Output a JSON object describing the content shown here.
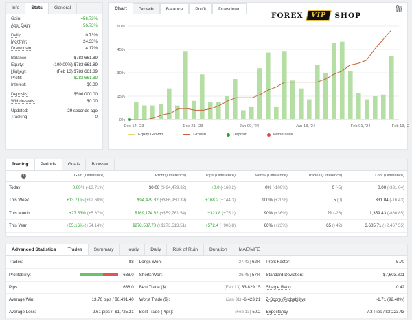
{
  "info_panel": {
    "tabs": [
      "Info",
      "Stats",
      "General"
    ],
    "rows_a": [
      {
        "label": "Gain:",
        "value": "+56.73%",
        "green": true
      },
      {
        "label": "Abs. Gain:",
        "value": "+56.73%",
        "green": true
      }
    ],
    "rows_b": [
      {
        "label": "Daily:",
        "value": "0.73%"
      },
      {
        "label": "Monthly:",
        "value": "24.33%"
      },
      {
        "label": "Drawdown:",
        "value": "4.17%"
      }
    ],
    "rows_c": [
      {
        "label": "Balance:",
        "value": "$783,661.89"
      },
      {
        "label": "Equity:",
        "value": "(100.00%) $783,661.89"
      },
      {
        "label": "Highest:",
        "value": "(Feb 13) $783,661.89"
      },
      {
        "label": "Profit:",
        "value": "$283,661.89",
        "green": true
      },
      {
        "label": "Interest:",
        "value": "$0.00"
      }
    ],
    "rows_d": [
      {
        "label": "Deposits:",
        "value": "$500,000.00"
      },
      {
        "label": "Withdrawals:",
        "value": "$0.00"
      }
    ],
    "rows_e": [
      {
        "label": "Updated:",
        "value": "29 seconds ago"
      },
      {
        "label": "Tracking",
        "value": "0"
      }
    ]
  },
  "chart_panel": {
    "tabs": [
      "Chart",
      "Growth",
      "Balance",
      "Profit",
      "Drawdown"
    ],
    "brand": {
      "left": "FOREX",
      "mid": "VIP",
      "right": "SHOP"
    },
    "settings_icon": "sliders-icon",
    "legend": [
      "Equity Growth",
      "Growth",
      "Deposit",
      "Withdrawal"
    ],
    "colors": {
      "bars": "#b5dea4",
      "growth": "#c8603a",
      "equity": "#e6d37a",
      "deposit": "#2e9e2e",
      "withdrawal": "#d94a4a"
    }
  },
  "chart_data": {
    "type": "bar",
    "y_ticks": [
      "60%",
      "45%",
      "30%",
      "15%",
      "0%"
    ],
    "ylim": [
      0,
      60
    ],
    "x_ticks": [
      "Dec 14, '23",
      "Dec 21, '23",
      "Jan 09, '24",
      "Jan 18, '24",
      "Feb 01, '24",
      "Feb 13, '24"
    ],
    "bars": [
      11,
      9,
      9,
      10,
      20,
      9,
      44,
      12,
      29,
      11,
      11,
      15,
      26,
      6,
      8,
      33,
      43,
      8,
      44,
      25,
      20,
      13,
      35,
      30,
      49,
      50,
      31,
      17,
      13,
      15,
      16,
      41
    ],
    "growth": [
      0,
      0,
      0,
      1,
      3,
      4,
      7,
      7,
      6,
      6,
      7,
      9,
      12,
      14,
      14,
      14,
      16,
      19,
      21,
      24,
      24,
      24,
      24,
      24,
      26,
      29,
      31,
      35,
      36,
      38,
      45,
      51,
      57
    ]
  },
  "periods_panel": {
    "tabs": [
      "Trading",
      "Periods",
      "Goals",
      "Browser"
    ],
    "info_icon": "info-icon",
    "headers": [
      "Gain (Difference)",
      "Profit (Difference)",
      "Pips (Difference)",
      "Win% (Difference)",
      "Trades (Difference)",
      "Lots (Difference)"
    ],
    "rows": [
      {
        "name": "Today",
        "gain": "+0.00%",
        "gain_d": "(-13.71%)",
        "profit": "$0.00",
        "profit_d": "($-94,479.32)",
        "pips": "+0.0",
        "pips_d": "(-168.2)",
        "win": "0%",
        "win_d": "(-100%)",
        "trades": "0",
        "trades_d": "(-5)",
        "lots": "0.00",
        "lots_d": "(-331.04)",
        "gain_color": "green",
        "profit_color": "plain",
        "pips_color": "green"
      },
      {
        "name": "This Week",
        "gain": "+13.71%",
        "gain_d": "(+12.60%)",
        "profit": "$94,479.32",
        "profit_d": "(+$86,950.39)",
        "pips": "+168.2",
        "pips_d": "(+144.3)",
        "win": "100%",
        "win_d": "(+20%)",
        "trades": "5",
        "trades_d": "(0)",
        "lots": "331.04",
        "lots_d": "(-16.43)",
        "gain_color": "green",
        "profit_color": "green",
        "pips_color": "green"
      },
      {
        "name": "This Month",
        "gain": "+27.53%",
        "gain_d": "(+5.87%)",
        "profit": "$169,174.62",
        "profit_d": "(+$59,761.54)",
        "pips": "+323.8",
        "pips_d": "(+75.2)",
        "win": "90%",
        "win_d": "(+36%)",
        "trades": "21",
        "trades_d": "(-23)",
        "lots": "1,359.43",
        "lots_d": "(-886.85)",
        "gain_color": "green",
        "profit_color": "green",
        "pips_color": "green"
      },
      {
        "name": "This Year",
        "gain": "+55.16%",
        "gain_d": "(+54.14%)",
        "profit": "$278,587.70",
        "profit_d": "(+$273,513.51)",
        "pips": "+572.4",
        "pips_d": "(+906.8)",
        "win": "66%",
        "win_d": "(+23%)",
        "trades": "65",
        "trades_d": "(+42)",
        "lots": "3,605.71",
        "lots_d": "(+2,467.55)",
        "gain_color": "green",
        "profit_color": "green",
        "pips_color": "green"
      }
    ]
  },
  "advanced_panel": {
    "tabs": [
      "Advanced Statistics",
      "Trades",
      "Summary",
      "Hourly",
      "Daily",
      "Risk of Ruin",
      "Duration",
      "MAE/MFE"
    ],
    "rows": [
      {
        "l1": "Trades:",
        "v1": "88",
        "l2": "Longs Won:",
        "v2m": "(27/43)",
        "v2": "62%",
        "l3": "Profit Factor:",
        "v3": "5.70"
      },
      {
        "l1": "Profitability:",
        "v1": "",
        "l2": "Shorts Won:",
        "v2m": "(26/45)",
        "v2": "57%",
        "l3": "Standard Deviation:",
        "v3": "$7,603.801"
      },
      {
        "l1": "Pips:",
        "v1": "638.0",
        "l2": "Best Trade ($):",
        "v2m": "(Feb 13)",
        "v2": "33,829.15",
        "l3": "Sharpe Ratio",
        "v3": "0.42"
      },
      {
        "l1": "Average Win:",
        "v1": "13.76 pips / $6,491.40",
        "l2": "Worst Trade ($):",
        "v2m": "(Jan 31)",
        "v2": "-6,423.21",
        "l3": "Z-Score (Probability):",
        "v3": "-1.71 (92.48%)"
      },
      {
        "l1": "Average Loss:",
        "v1": "-2.61 pips / -$1,725.21",
        "l2": "Best Trade (Pips):",
        "v2m": "(Feb 13)",
        "v2": "50.2",
        "l3": "Expectancy",
        "v3": "7.3 Pips / $3,223.43"
      }
    ],
    "profitability_fraction": 0.6
  }
}
